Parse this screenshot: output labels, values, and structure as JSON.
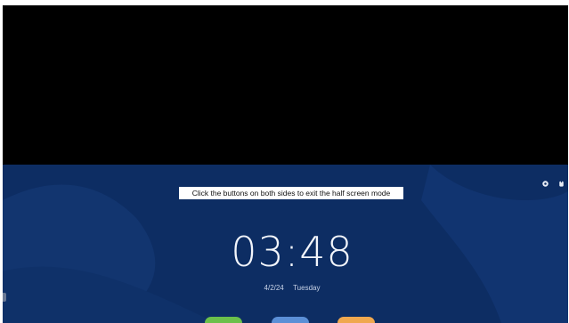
{
  "overlay": {
    "hint_text": "Click the buttons on both sides to exit the half screen mode"
  },
  "lockscreen": {
    "time": "03:48",
    "date": "4/2/24",
    "weekday": "Tuesday"
  },
  "status_icons": [
    "settings-icon",
    "power-icon"
  ],
  "dock": [
    {
      "icon": "app-green-icon",
      "color": "#6bc04b"
    },
    {
      "icon": "app-blue-icon",
      "color": "#5b8fd6"
    },
    {
      "icon": "app-orange-icon",
      "color": "#f0a84f"
    }
  ],
  "colors": {
    "background_top": "#000000",
    "background_bottom": "#0d2d63",
    "wave": "#143a78"
  }
}
